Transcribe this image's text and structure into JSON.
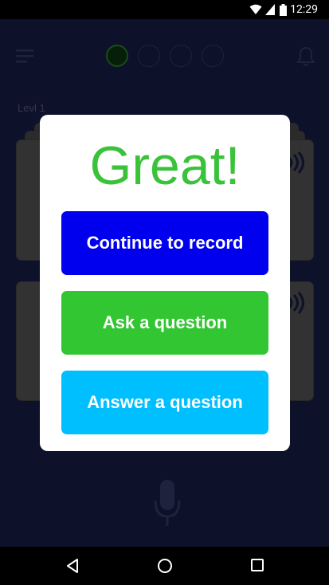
{
  "status_bar": {
    "time": "12:29"
  },
  "header": {
    "progress_steps": 4,
    "active_step": 1
  },
  "level_label": "Levl 1",
  "dialog": {
    "title": "Great!",
    "buttons": [
      {
        "label": "Continue to record",
        "color": "#0000ee"
      },
      {
        "label": "Ask a question",
        "color": "#33c633"
      },
      {
        "label": "Answer a question",
        "color": "#00bfff"
      }
    ]
  },
  "colors": {
    "app_background": "#1a1f4d",
    "title_green": "#3ac23a"
  },
  "icons": {
    "menu": "menu-icon",
    "bell": "bell-icon",
    "mic": "microphone-icon",
    "card_audio": "audio-wave-icon",
    "nav_back": "back-triangle-icon",
    "nav_home": "home-circle-icon",
    "nav_recents": "recents-square-icon"
  }
}
